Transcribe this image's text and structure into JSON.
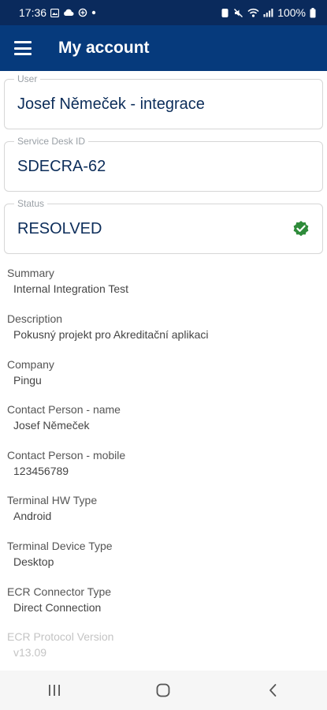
{
  "status_bar": {
    "time": "17:36",
    "battery": "100%"
  },
  "app_bar": {
    "title": "My account"
  },
  "fields": [
    {
      "label": "User",
      "value": "Josef Němeček - integrace"
    },
    {
      "label": "Service Desk ID",
      "value": "SDECRA-62"
    },
    {
      "label": "Status",
      "value": "RESOLVED",
      "status_color": "#2e8b3a"
    }
  ],
  "info": [
    {
      "label": "Summary",
      "value": "Internal Integration Test"
    },
    {
      "label": "Description",
      "value": "Pokusný projekt pro Akreditační aplikaci"
    },
    {
      "label": "Company",
      "value": "Pingu"
    },
    {
      "label": "Contact Person - name",
      "value": "Josef Němeček"
    },
    {
      "label": "Contact Person - mobile",
      "value": "123456789"
    },
    {
      "label": "Terminal HW Type",
      "value": "Android"
    },
    {
      "label": "Terminal Device Type",
      "value": "Desktop"
    },
    {
      "label": "ECR Connector Type",
      "value": "Direct Connection"
    },
    {
      "label": "ECR Protocol Version",
      "value": "v13.09"
    }
  ],
  "colors": {
    "status_bar": "#0a2a5c",
    "app_bar": "#063a7c",
    "value_text": "#0c2d5a",
    "resolved_check": "#2e8b3a"
  },
  "icons": {
    "menu": "hamburger-icon",
    "status": "check-circle-icon",
    "nav": [
      "recent-apps-icon",
      "home-icon",
      "back-icon"
    ]
  }
}
